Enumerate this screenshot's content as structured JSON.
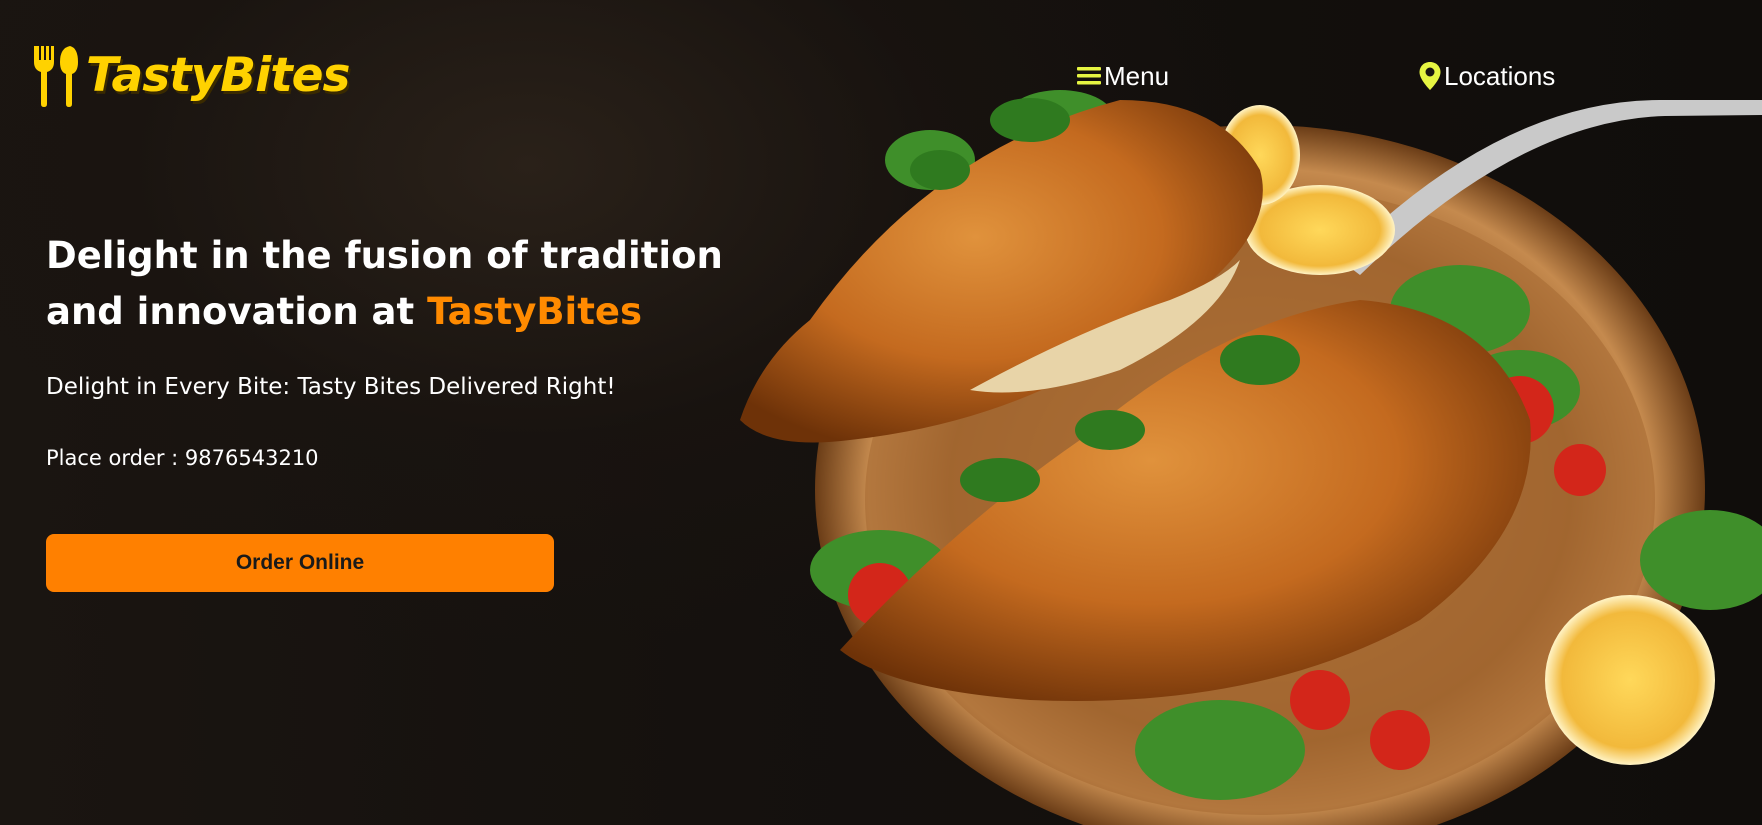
{
  "brand": {
    "name": "TastyBites",
    "logo_icon": "fork-spoon-icon",
    "color": "#ffd200"
  },
  "nav": {
    "menu_label": "Menu",
    "menu_icon": "hamburger-icon",
    "locations_label": "Locations",
    "locations_icon": "map-pin-icon",
    "icon_color": "#e6f542"
  },
  "hero": {
    "headline_part1": "Delight in the fusion of tradition and innovation at ",
    "headline_brand": "TastyBites",
    "tagline": "Delight in Every Bite: Tasty Bites Delivered Right!",
    "phone_text": "Place order : 9876543210",
    "cta_label": "Order Online",
    "accent_color": "#ff8000",
    "image": "roasted-chicken-plate"
  }
}
